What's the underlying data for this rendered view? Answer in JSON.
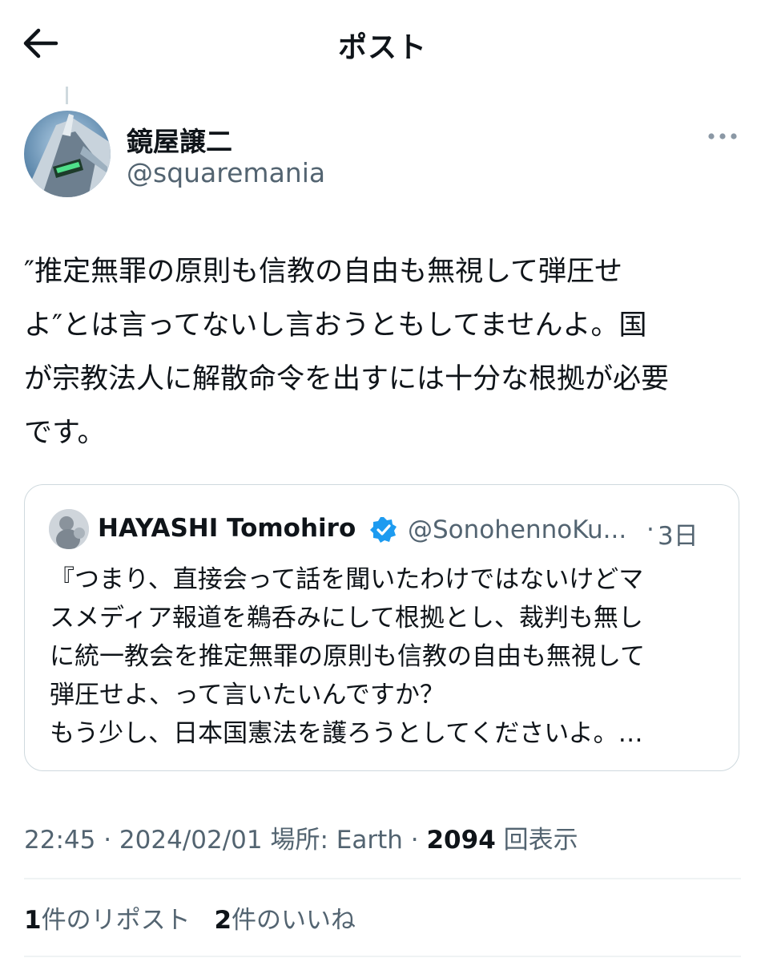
{
  "header": {
    "title": "ポスト",
    "back_icon": "arrow-left-icon"
  },
  "post": {
    "author_name": "鏡屋譲二",
    "author_handle": "@squaremania",
    "more_icon": "more-horizontal-icon",
    "text": "″推定無罪の原則も信教の自由も無視して弾圧せ\nよ″とは言ってないし言おうともしてませんよ。国\nが宗教法人に解散命令を出すには十分な根拠が必要\nです。",
    "time": "22:45",
    "date": "2024/02/01",
    "location_label": "場所: Earth",
    "views": "2094",
    "views_label": "回表示",
    "reposts_count": "1",
    "reposts_label": "件のリポスト",
    "likes_count": "2",
    "likes_label": "件のいいね"
  },
  "quote": {
    "author_name": "HAYASHI Tomohiro",
    "author_handle": "@SonohennoKu...",
    "time": "3日",
    "verified_icon": "verified-badge-icon",
    "text": "『つまり、直接会って話を聞いたわけではないけどマ\nスメディア報道を鵜呑みにして根拠とし、裁判も無し\nに統一教会を推定無罪の原則も信教の自由も無視して\n弾圧せよ、って言いたいんですか？\nもう少し、日本国憲法を護ろうとしてくださいよ。…"
  },
  "colors": {
    "text": "#0f1419",
    "secondary": "#536471",
    "border": "#cfd9de",
    "verified": "#1d9bf0"
  }
}
